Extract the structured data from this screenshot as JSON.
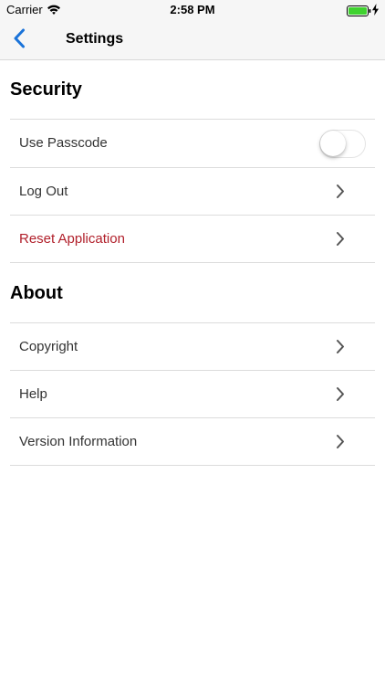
{
  "status_bar": {
    "carrier": "Carrier",
    "time": "2:58 PM",
    "battery_color": "#3fd22f"
  },
  "nav": {
    "back_icon": "chevron-left-icon",
    "title": "Settings",
    "accent_color": "#1a73d9"
  },
  "sections": {
    "security": {
      "header": "Security",
      "use_passcode": {
        "label": "Use Passcode",
        "enabled": false
      },
      "log_out": {
        "label": "Log Out"
      },
      "reset_application": {
        "label": "Reset Application",
        "color": "#b1202b"
      }
    },
    "about": {
      "header": "About",
      "copyright": {
        "label": "Copyright"
      },
      "help": {
        "label": "Help"
      },
      "version_information": {
        "label": "Version Information"
      }
    }
  }
}
